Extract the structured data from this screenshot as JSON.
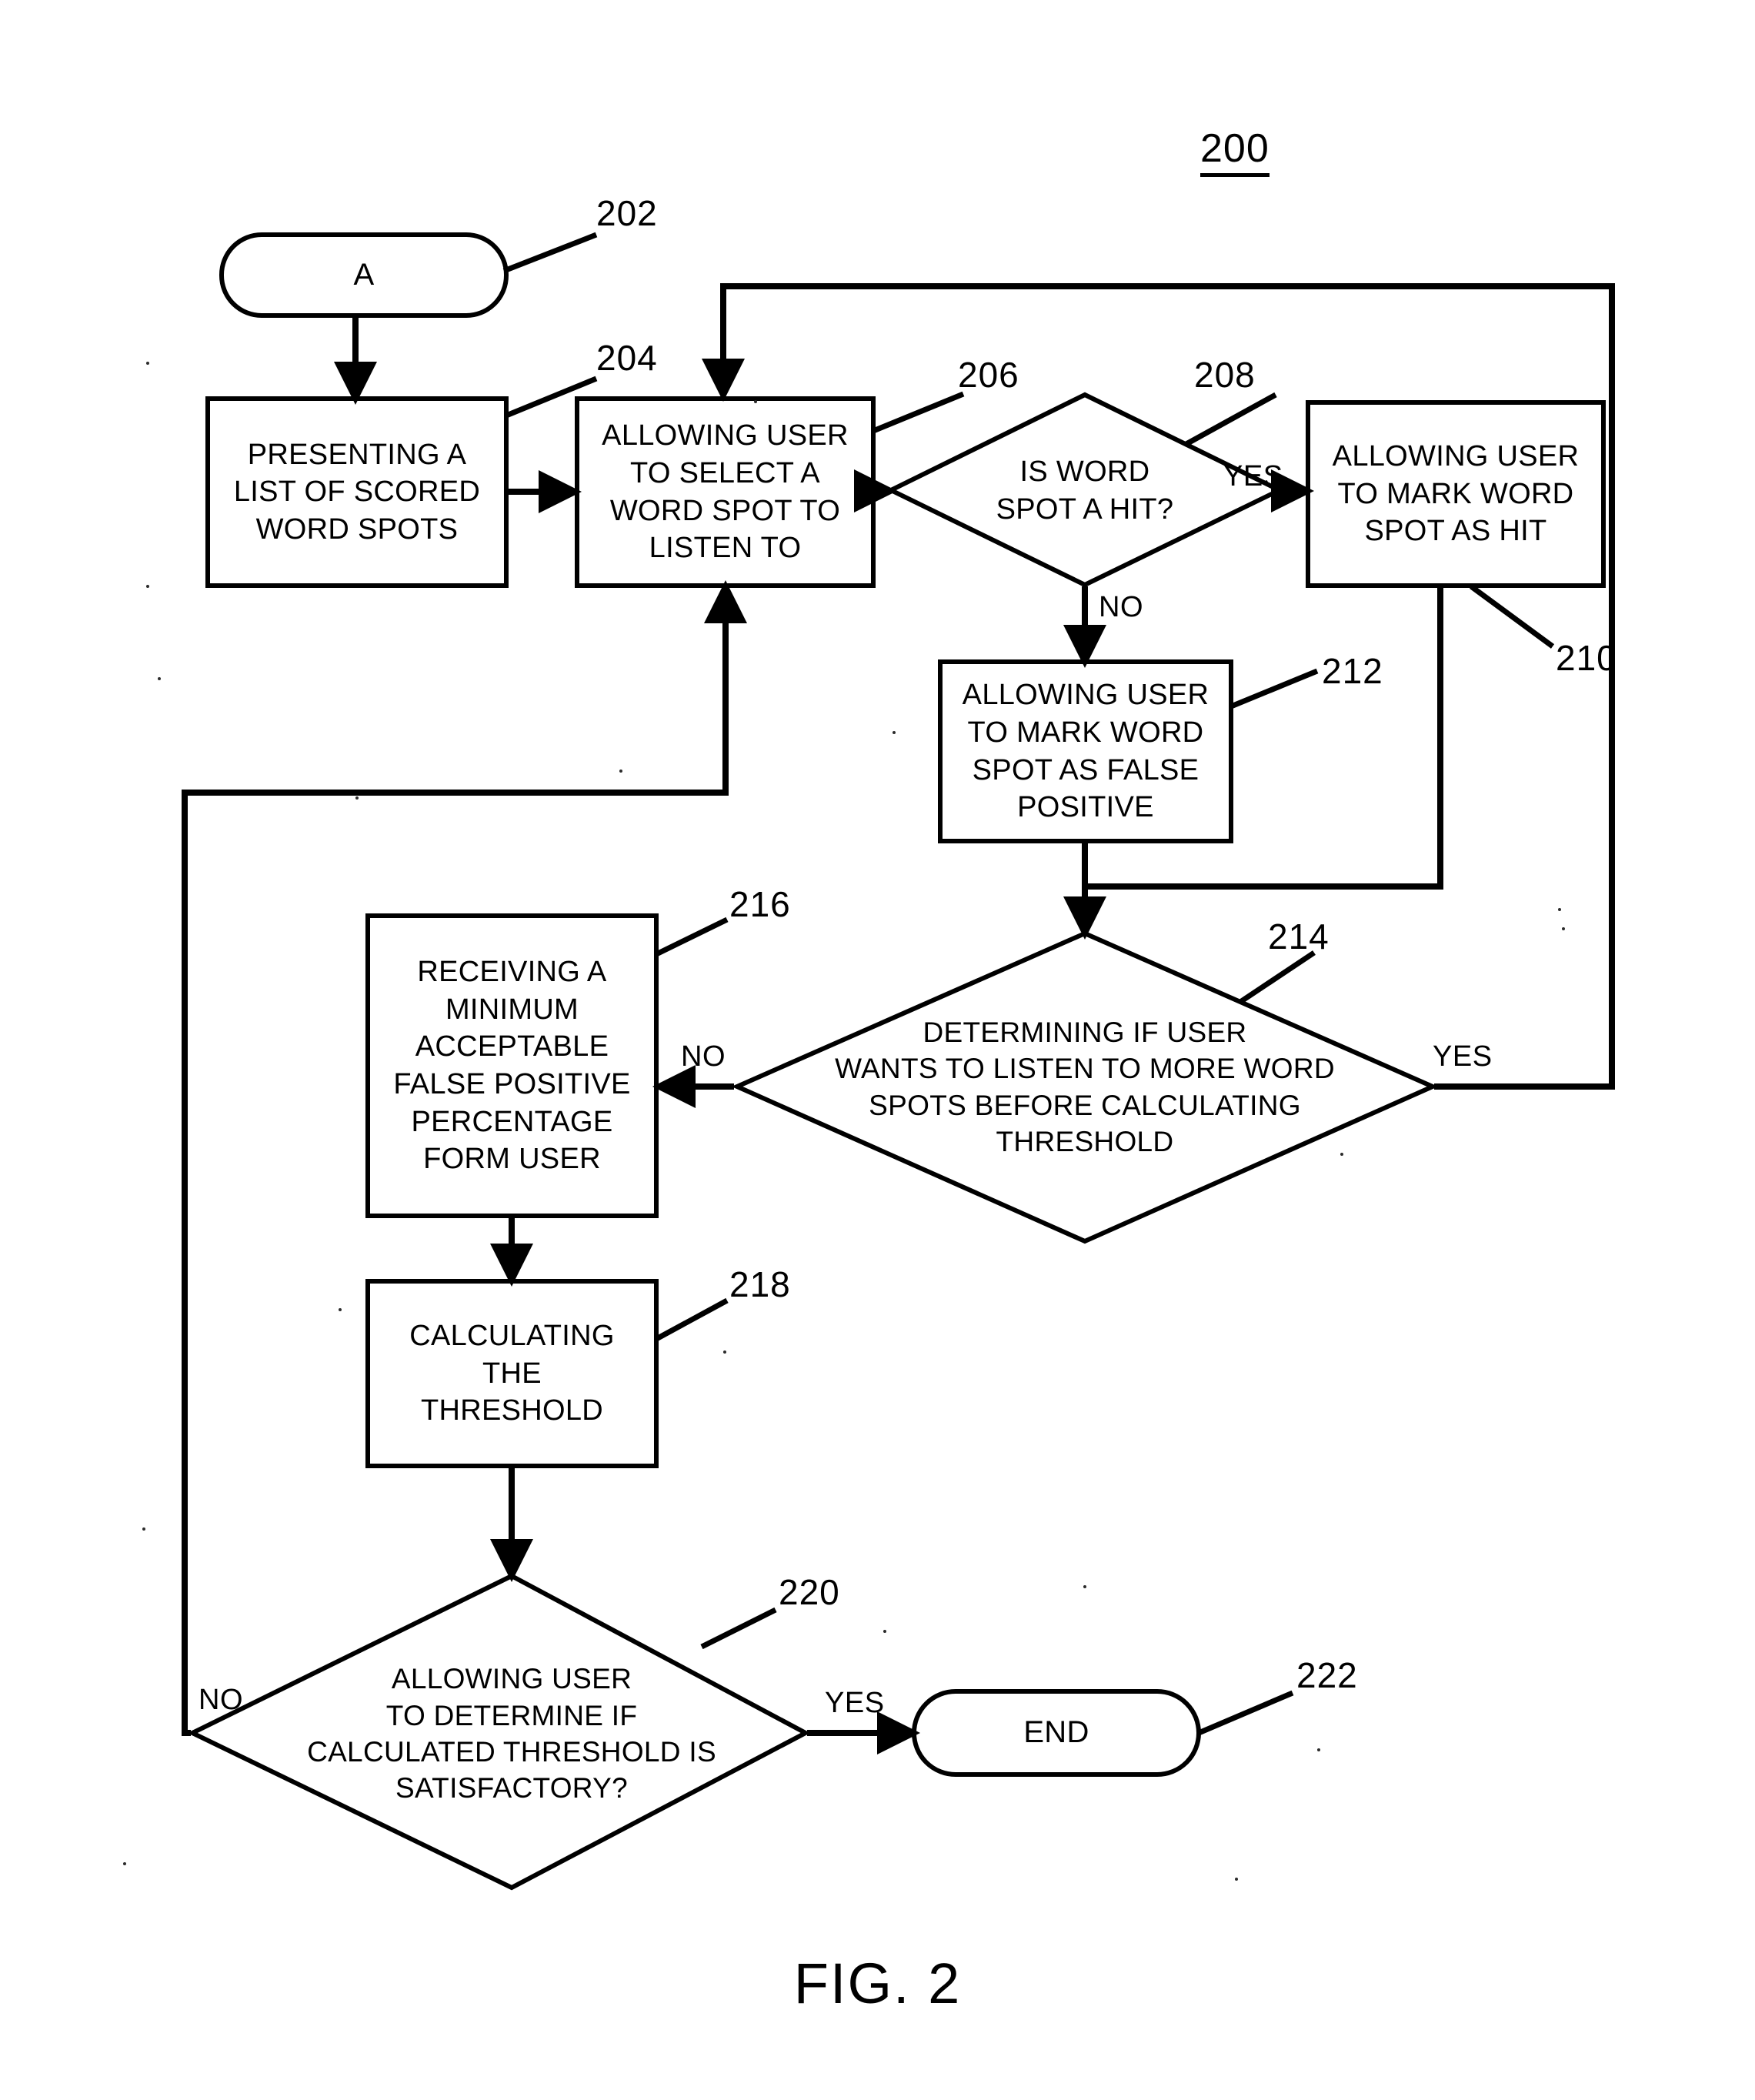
{
  "figure": {
    "number": "200",
    "caption": "FIG. 2"
  },
  "nodes": [
    {
      "id": "202",
      "ref": "202",
      "shape": "terminator",
      "label": "A"
    },
    {
      "id": "204",
      "ref": "204",
      "shape": "process",
      "label": "PRESENTING A\nLIST OF SCORED\nWORD SPOTS"
    },
    {
      "id": "206",
      "ref": "206",
      "shape": "process",
      "label": "ALLOWING USER\nTO SELECT A\nWORD SPOT TO\nLISTEN TO"
    },
    {
      "id": "208",
      "ref": "208",
      "shape": "decision",
      "label": "IS WORD\nSPOT A HIT?"
    },
    {
      "id": "210",
      "ref": "210",
      "shape": "process",
      "label": "ALLOWING USER\nTO MARK WORD\nSPOT AS HIT"
    },
    {
      "id": "212",
      "ref": "212",
      "shape": "process",
      "label": "ALLOWING USER\nTO MARK WORD\nSPOT AS FALSE\nPOSITIVE"
    },
    {
      "id": "214",
      "ref": "214",
      "shape": "decision",
      "label": "DETERMINING IF USER\nWANTS TO LISTEN TO MORE WORD\nSPOTS BEFORE CALCULATING\nTHRESHOLD"
    },
    {
      "id": "216",
      "ref": "216",
      "shape": "process",
      "label": "RECEIVING A\nMINIMUM\nACCEPTABLE\nFALSE POSITIVE\nPERCENTAGE\nFORM USER"
    },
    {
      "id": "218",
      "ref": "218",
      "shape": "process",
      "label": "CALCULATING\nTHE\nTHRESHOLD"
    },
    {
      "id": "220",
      "ref": "220",
      "shape": "decision",
      "label": "ALLOWING USER\nTO DETERMINE IF\nCALCULATED THRESHOLD IS\nSATISFACTORY?"
    },
    {
      "id": "222",
      "ref": "222",
      "shape": "terminator",
      "label": "END"
    }
  ],
  "edge_labels": {
    "hit_yes": "YES",
    "hit_no": "NO",
    "more_spots_no": "NO",
    "more_spots_yes": "YES",
    "satisfactory_no": "NO",
    "satisfactory_yes": "YES"
  },
  "refs": {
    "r202": "202",
    "r204": "204",
    "r206": "206",
    "r208": "208",
    "r210": "210",
    "r212": "212",
    "r214": "214",
    "r216": "216",
    "r218": "218",
    "r220": "220",
    "r222": "222"
  },
  "style": {
    "stroke": "#000000",
    "background": "#ffffff"
  }
}
